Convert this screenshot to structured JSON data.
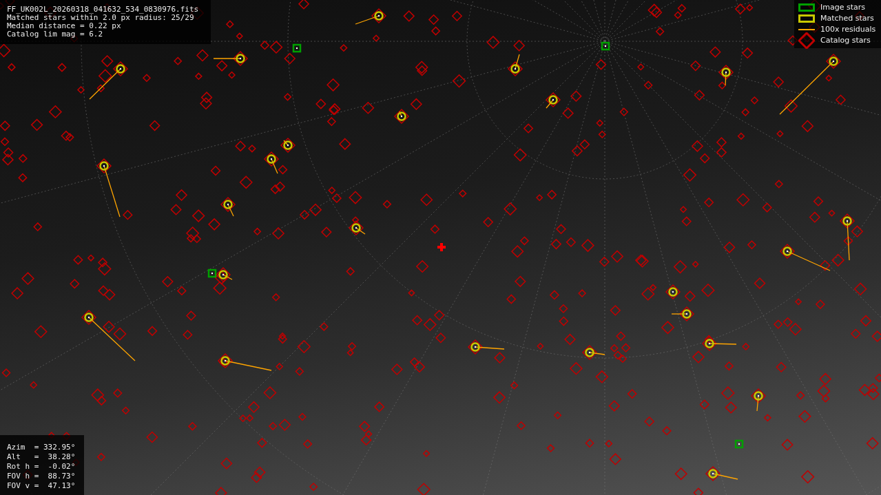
{
  "header": {
    "lines": [
      "FF_UK002L_20260318_041632_534_0830976.fits",
      "Matched stars within 2.0 px radius: 25/29",
      "Median distance = 0.22 px",
      "Catalog lim mag = 6.2"
    ]
  },
  "legend": [
    {
      "kind": "image",
      "label": "Image stars",
      "color": "#00a000"
    },
    {
      "kind": "matched",
      "label": "Matched stars",
      "color": "#c8c800"
    },
    {
      "kind": "residual",
      "label": "100x residuals",
      "color": "#ffa500"
    },
    {
      "kind": "catalog",
      "label": "Catalog stars",
      "color": "#c00000"
    }
  ],
  "pointing": {
    "lines": [
      "Azim  = 332.95°",
      "Alt   =  38.28°",
      "Rot h =  -0.02°",
      "FOV h =  88.73°",
      "FOV v =  47.13°"
    ]
  }
}
